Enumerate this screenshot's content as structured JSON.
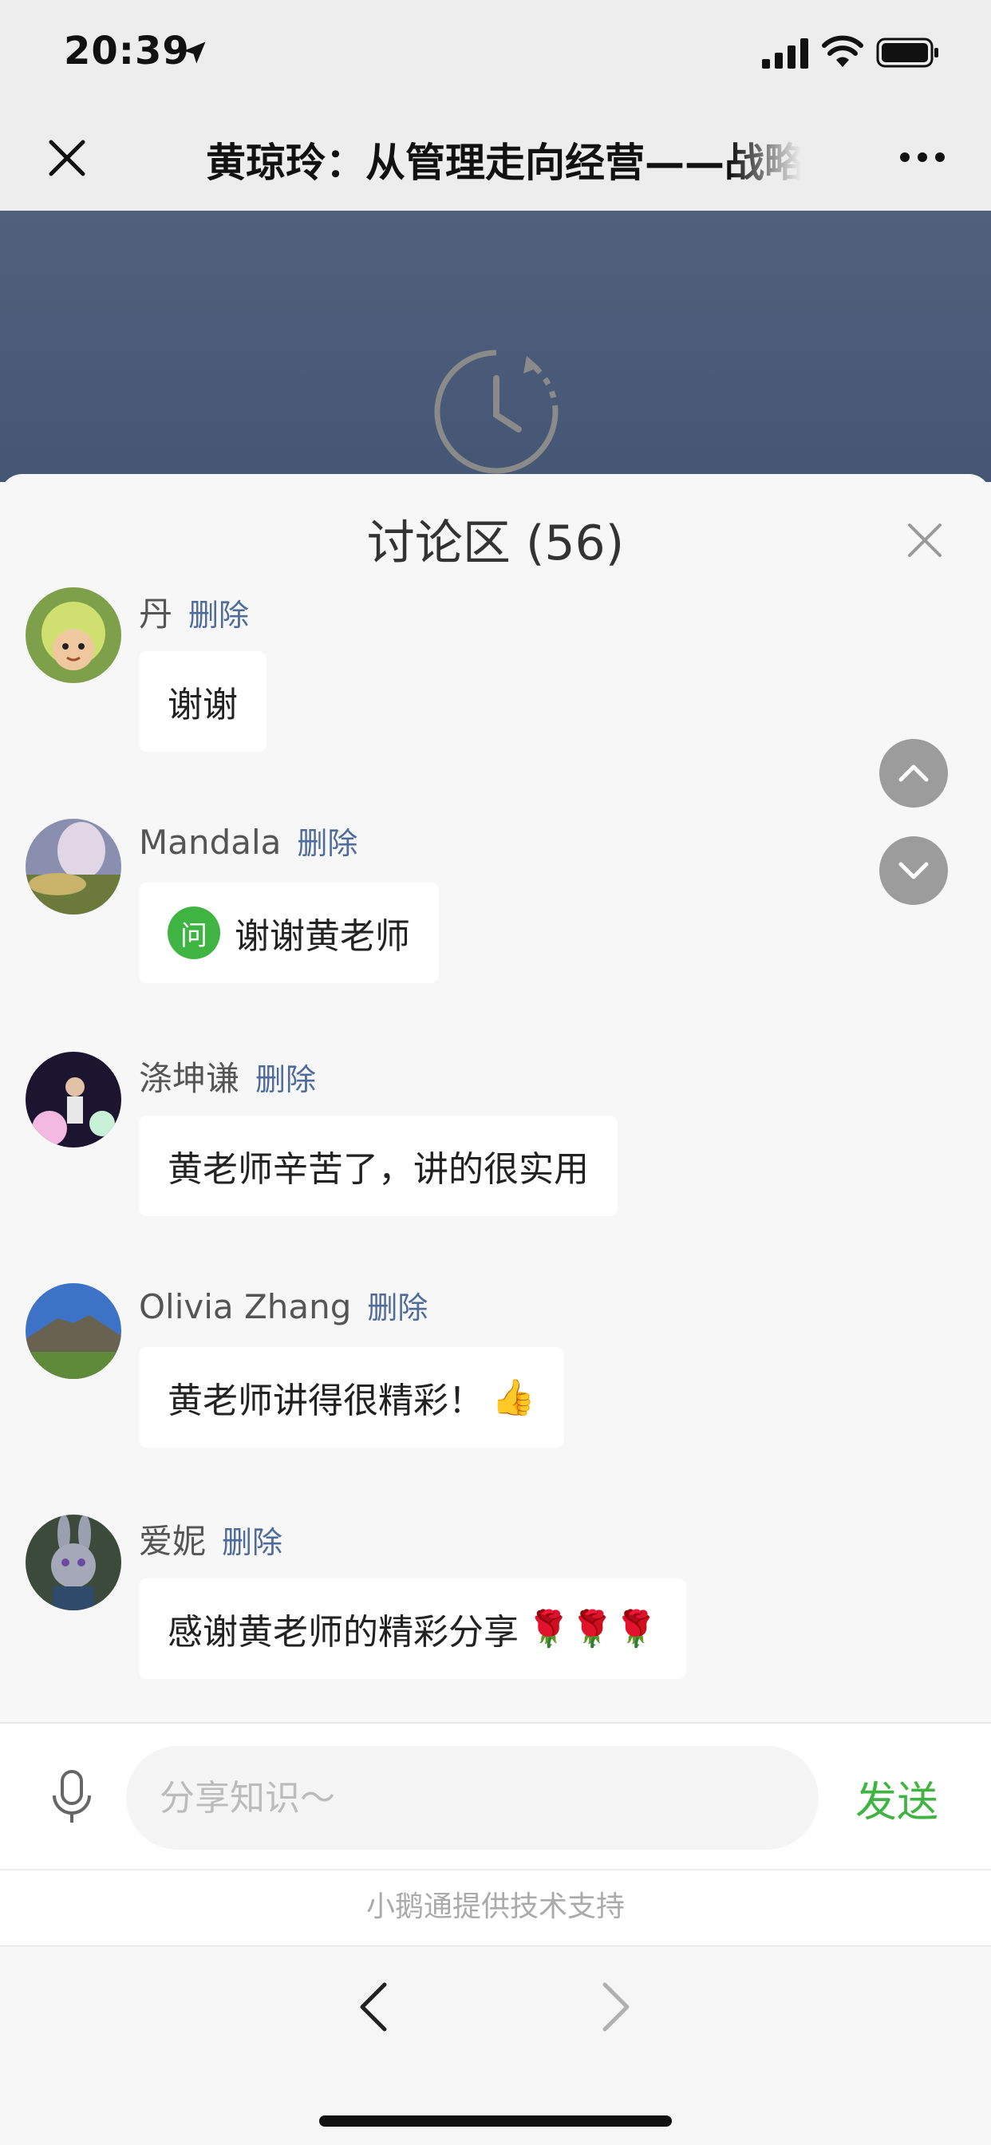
{
  "status_bar": {
    "time": "20:39"
  },
  "nav": {
    "title": "黄琼玲：从管理走向经营——战略"
  },
  "panel": {
    "title": "讨论区 (56)"
  },
  "colors": {
    "accent": "#3fb443",
    "delete_link": "#4e6b9b",
    "video_bg": "#4a5b78"
  },
  "comments": [
    {
      "name": "丹",
      "action": "删除",
      "text": "谢谢",
      "avatar_icon": "avatar-icon"
    },
    {
      "name": "Mandala",
      "action": "删除",
      "badge": "问",
      "text": "谢谢黄老师",
      "avatar_icon": "avatar-icon"
    },
    {
      "name": "涤坤谦",
      "action": "删除",
      "text": "黄老师辛苦了，讲的很实用",
      "avatar_icon": "avatar-icon"
    },
    {
      "name": "Olivia Zhang",
      "action": "删除",
      "text": "黄老师讲得很精彩！",
      "emoji": "👍",
      "avatar_icon": "avatar-icon"
    },
    {
      "name": "爱妮",
      "action": "删除",
      "text": "感谢黄老师的精彩分享",
      "emoji": "🌹🌹🌹",
      "avatar_icon": "avatar-icon"
    }
  ],
  "input": {
    "placeholder": "分享知识～",
    "send_label": "发送"
  },
  "footer": {
    "credit": "小鹅通提供技术支持"
  }
}
